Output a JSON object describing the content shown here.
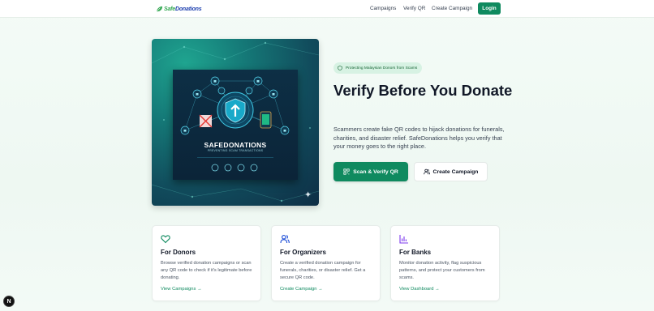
{
  "header": {
    "logo": {
      "part1": "Safe",
      "part2": "Donations"
    },
    "nav": [
      "Campaigns",
      "Verify QR",
      "Create Campaign"
    ],
    "login_label": "Login"
  },
  "hero": {
    "badge": "Protecting Malaysian Donors from Scams",
    "title": "Verify Before You Donate",
    "description": "Scammers create fake QR codes to hijack donations for funerals, charities, and disaster relief. SafeDonations helps you verify that your money goes to the right place.",
    "primary_button": "Scan & Verify QR",
    "secondary_button": "Create Campaign",
    "image": {
      "title": "SAFEDONATIONS",
      "subtitle": "PREVENTING SCAM TRANSACTIONS"
    }
  },
  "cards": [
    {
      "icon": "heart-icon",
      "title": "For Donors",
      "text": "Browse verified donation campaigns or scan any QR code to check if it's legitimate before donating.",
      "link": "View Campaigns →"
    },
    {
      "icon": "users-icon",
      "title": "For Organizers",
      "text": "Create a verified donation campaign for funerals, charities, or disaster relief. Get a secure QR code.",
      "link": "Create Campaign →"
    },
    {
      "icon": "bar-chart-icon",
      "title": "For Banks",
      "text": "Monitor donation activity, flag suspicious patterns, and protect your customers from scams.",
      "link": "View Dashboard →"
    }
  ],
  "fab_label": "N",
  "colors": {
    "accent": "#0f8a5f",
    "badge_bg": "#d7f2e3",
    "dark_text": "#111827"
  }
}
